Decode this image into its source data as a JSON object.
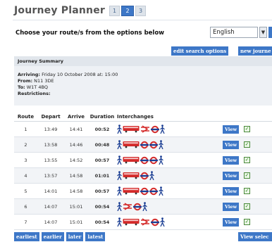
{
  "header": {
    "title": "Journey Planner",
    "steps": [
      "1",
      "2",
      "3"
    ],
    "active_step": "2"
  },
  "choose_label": "Choose your route/s from the options below",
  "language": {
    "selected": "English"
  },
  "buttons": {
    "edit_search": "edit search options",
    "new_journey": "new journe"
  },
  "summary": {
    "heading": "Journey Summary",
    "arriving_label": "Arriving:",
    "arriving_value": "Friday  10  October  2008 at: 15:00",
    "from_label": "From:",
    "from_value": "N11 3DE",
    "to_label": "To:",
    "to_value": "W1T 4BQ",
    "restrictions_label": "Restrictions:"
  },
  "table": {
    "columns": [
      "Route",
      "Depart",
      "Arrive",
      "Duration",
      "Interchanges"
    ],
    "view_label": "View",
    "rows": [
      {
        "route": "1",
        "depart": "13:49",
        "arrive": "14:41",
        "duration": "00:52",
        "modes": [
          "walk",
          "bus",
          "rail",
          "tube",
          "walk"
        ]
      },
      {
        "route": "2",
        "depart": "13:58",
        "arrive": "14:46",
        "duration": "00:48",
        "modes": [
          "walk",
          "bus",
          "tube",
          "tube",
          "walk"
        ]
      },
      {
        "route": "3",
        "depart": "13:55",
        "arrive": "14:52",
        "duration": "00:57",
        "modes": [
          "walk",
          "bus",
          "tube",
          "tube",
          "walk"
        ]
      },
      {
        "route": "4",
        "depart": "13:57",
        "arrive": "14:58",
        "duration": "01:01",
        "modes": [
          "walk",
          "bus",
          "tube",
          "walk"
        ]
      },
      {
        "route": "5",
        "depart": "14:01",
        "arrive": "14:58",
        "duration": "00:57",
        "modes": [
          "walk",
          "bus",
          "tube",
          "tube",
          "walk"
        ]
      },
      {
        "route": "6",
        "depart": "14:07",
        "arrive": "15:01",
        "duration": "00:54",
        "modes": [
          "walk",
          "rail",
          "tube",
          "walk"
        ]
      },
      {
        "route": "7",
        "depart": "14:07",
        "arrive": "15:01",
        "duration": "00:54",
        "modes": [
          "walk",
          "bus",
          "rail",
          "tube",
          "walk"
        ]
      }
    ]
  },
  "footer": {
    "earliest": "earliest",
    "earlier": "earlier",
    "later": "later",
    "latest": "latest",
    "view_selected": "View selec"
  },
  "colors": {
    "accent_blue": "#3d77c7",
    "bus_red": "#d42a2a",
    "tube_blue": "#1c3f94",
    "walk_blue": "#1c3f94",
    "check_green": "#2f8a1f"
  }
}
